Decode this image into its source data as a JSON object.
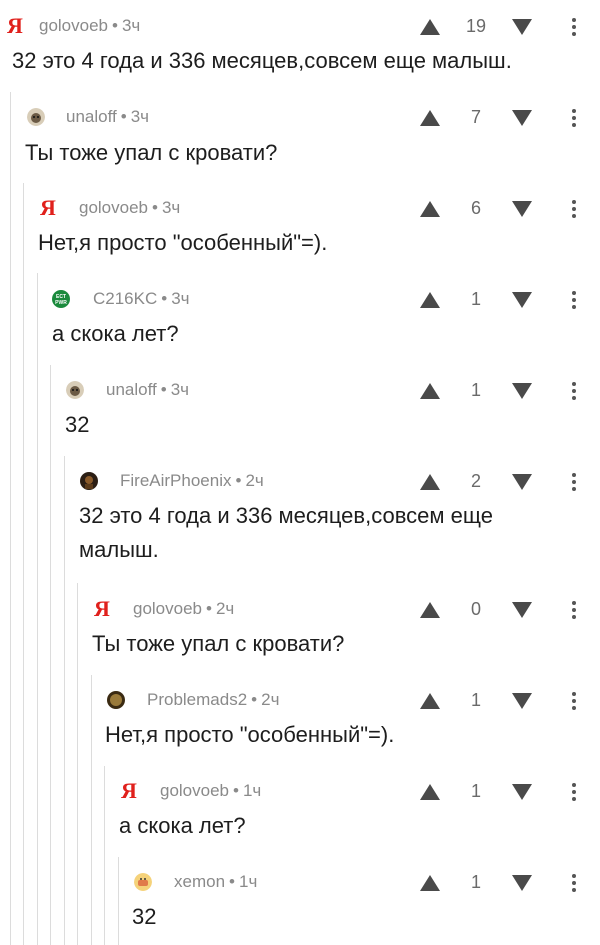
{
  "comments": [
    {
      "user": "golovoeb",
      "time": "3ч",
      "score": "19",
      "text": "32 это 4 года и 336 месяцев,совсем еще малыш.",
      "avatar": "yandex-avatar-icon"
    },
    {
      "user": "unaloff",
      "time": "3ч",
      "score": "7",
      "text": "Ты тоже упал с кровати?",
      "avatar": "pug-avatar-icon"
    },
    {
      "user": "golovoeb",
      "time": "3ч",
      "score": "6",
      "text": "Нет,я просто \"особенный\"=).",
      "avatar": "yandex-avatar-icon"
    },
    {
      "user": "C216KC",
      "time": "3ч",
      "score": "1",
      "text": "а скока лет?",
      "avatar": "ect-pwr-avatar-icon",
      "avatar_text": [
        "ECT",
        "PWR"
      ]
    },
    {
      "user": "unaloff",
      "time": "3ч",
      "score": "1",
      "text": "32",
      "avatar": "pug-avatar-icon"
    },
    {
      "user": "FireAirPhoenix",
      "time": "2ч",
      "score": "2",
      "text": "32 это 4 года и 336 месяцев,совсем еще малыш.",
      "avatar": "dark-figure-avatar-icon"
    },
    {
      "user": "golovoeb",
      "time": "2ч",
      "score": "0",
      "text": "Ты тоже упал с кровати?",
      "avatar": "yandex-avatar-icon"
    },
    {
      "user": "Problemads2",
      "time": "2ч",
      "score": "1",
      "text": "Нет,я просто \"особенный\"=).",
      "avatar": "brown-avatar-icon"
    },
    {
      "user": "golovoeb",
      "time": "1ч",
      "score": "1",
      "text": "а скока лет?",
      "avatar": "yandex-avatar-icon"
    },
    {
      "user": "xemon",
      "time": "1ч",
      "score": "1",
      "text": "32",
      "avatar": "emoji-avatar-icon"
    }
  ],
  "yandex_glyph": "Я",
  "separator": "•",
  "colors": {
    "yandex_red": "#e0201c",
    "thread_line": "#dcdcdc",
    "meta": "#8a8a8a",
    "icon": "#4a4a4a"
  }
}
